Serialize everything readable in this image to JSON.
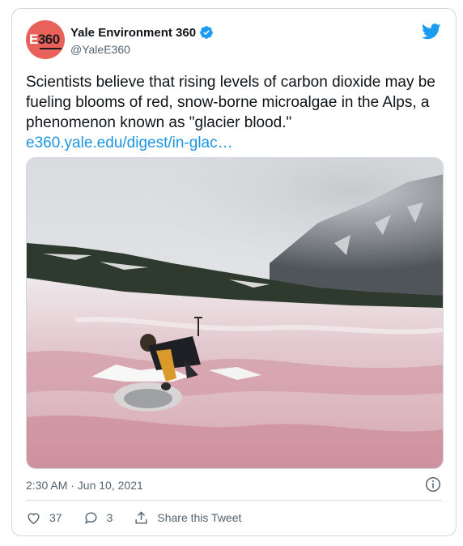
{
  "tweet": {
    "display_name": "Yale Environment 360",
    "handle": "@YaleE360",
    "avatar_text": "360",
    "avatar_letter": "E",
    "text": "Scientists believe that rising levels of carbon dioxide may be fueling blooms of red, snow-borne microalgae in the Alps, a phenomenon known as \"glacier blood.\"",
    "link": "e360.yale.edu/digest/in-glac…",
    "timestamp": "2:30 AM · Jun 10, 2021"
  },
  "actions": {
    "likes": "37",
    "replies": "3",
    "share_label": "Share this Tweet"
  },
  "icons": [
    "twitter-bird-icon",
    "verified-badge-icon",
    "info-icon",
    "heart-icon",
    "reply-icon",
    "share-icon"
  ],
  "colors": {
    "avatar_bg": "#e8615a",
    "link": "#1b95e0",
    "brand_blue": "#1d9bf0",
    "muted": "#536471",
    "border": "#cfd9de"
  }
}
